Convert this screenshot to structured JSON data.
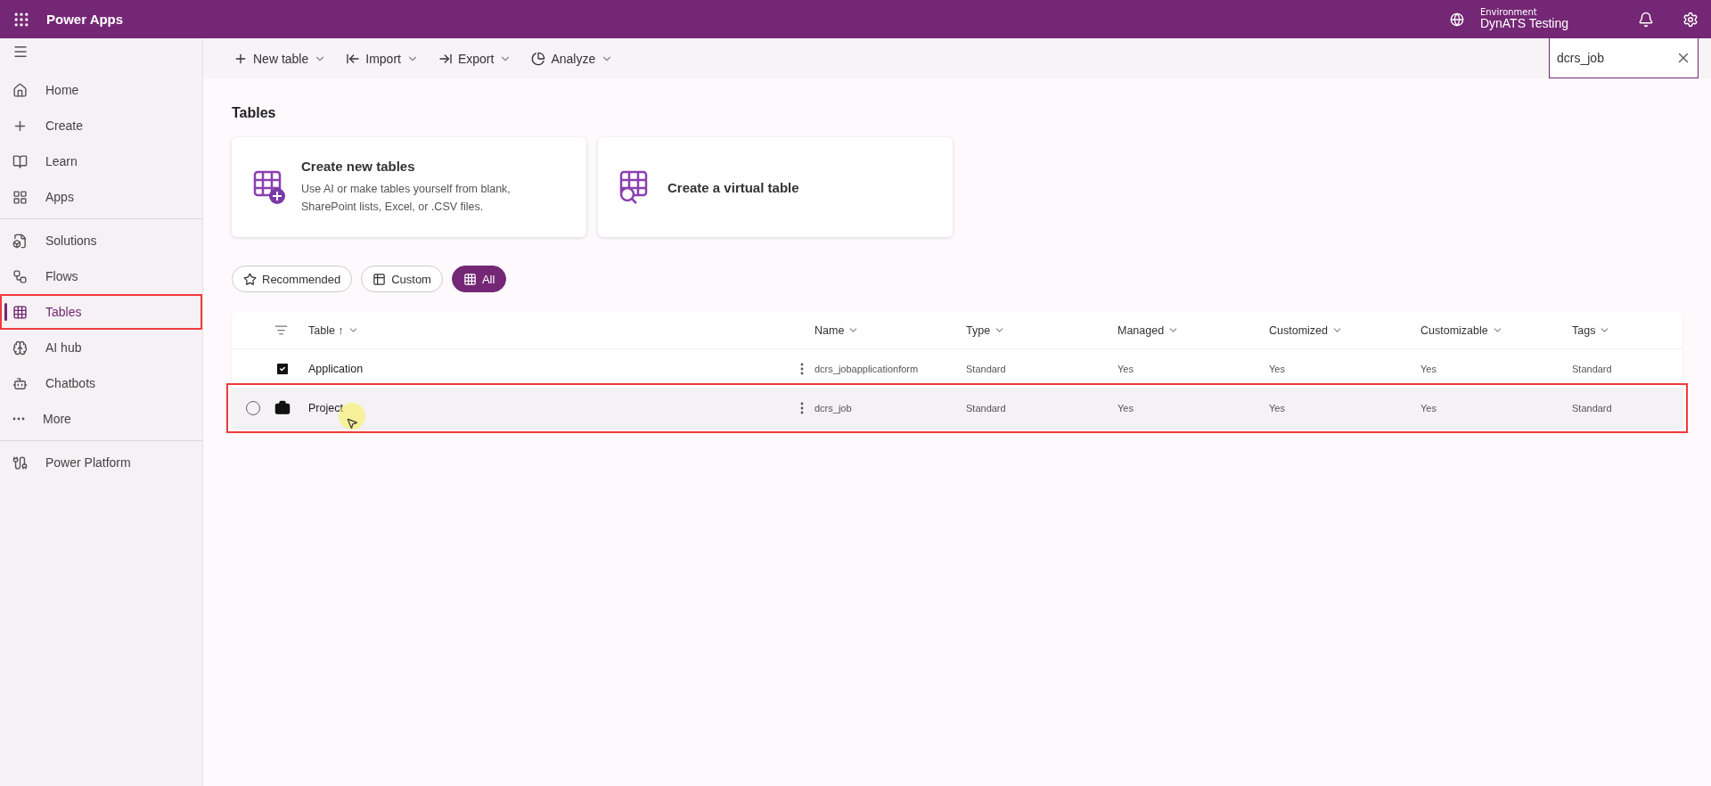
{
  "app_bar": {
    "title": "Power Apps",
    "environment_label": "Environment",
    "environment_name": "DynATS Testing"
  },
  "sidebar": {
    "groups": [
      [
        {
          "label": "Home",
          "selected": false,
          "annotated": false
        },
        {
          "label": "Create",
          "selected": false,
          "annotated": false
        },
        {
          "label": "Learn",
          "selected": false,
          "annotated": false
        },
        {
          "label": "Apps",
          "selected": false,
          "annotated": false
        }
      ],
      [
        {
          "label": "Solutions",
          "selected": false,
          "annotated": false
        },
        {
          "label": "Flows",
          "selected": false,
          "annotated": false
        },
        {
          "label": "Tables",
          "selected": true,
          "annotated": true
        },
        {
          "label": "AI hub",
          "selected": false,
          "annotated": false
        },
        {
          "label": "Chatbots",
          "selected": false,
          "annotated": false
        },
        {
          "label": "More",
          "selected": false,
          "annotated": false
        }
      ],
      [
        {
          "label": "Power Platform",
          "selected": false,
          "annotated": false
        }
      ]
    ]
  },
  "command_bar": [
    {
      "label": "New table"
    },
    {
      "label": "Import"
    },
    {
      "label": "Export"
    },
    {
      "label": "Analyze"
    }
  ],
  "search": {
    "value": "dcrs_job"
  },
  "page_title": "Tables",
  "cards": [
    {
      "title": "Create new tables",
      "description": "Use AI or make tables yourself from blank, SharePoint lists, Excel, or .CSV files."
    },
    {
      "title": "Create a virtual table"
    }
  ],
  "filters": [
    {
      "label": "Recommended",
      "selected": false
    },
    {
      "label": "Custom",
      "selected": false
    },
    {
      "label": "All",
      "selected": true
    }
  ],
  "table": {
    "columns": [
      {
        "label": "Table",
        "sort": "↑"
      },
      {
        "label": "Name"
      },
      {
        "label": "Type"
      },
      {
        "label": "Managed"
      },
      {
        "label": "Customized"
      },
      {
        "label": "Customizable"
      },
      {
        "label": "Tags"
      }
    ],
    "rows": [
      {
        "hovered": false,
        "annotated": false,
        "cells": [
          "Application",
          "dcrs_jobapplicationform",
          "Standard",
          "Yes",
          "Yes",
          "Yes",
          "Standard"
        ]
      },
      {
        "hovered": true,
        "annotated": true,
        "cells": [
          "Project",
          "dcrs_job",
          "Standard",
          "Yes",
          "Yes",
          "Yes",
          "Standard"
        ]
      }
    ]
  }
}
